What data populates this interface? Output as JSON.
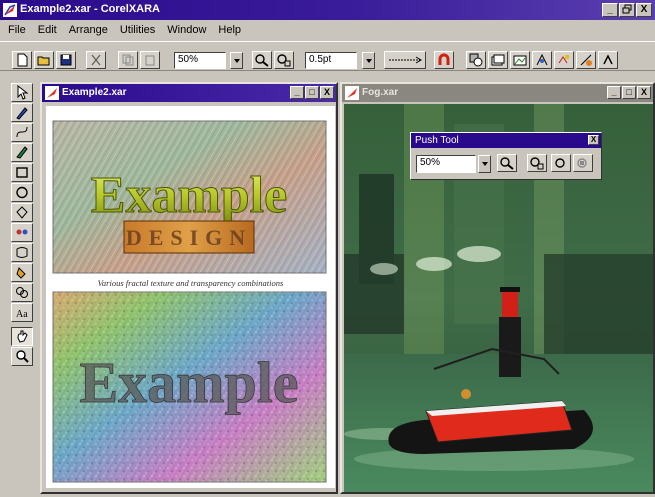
{
  "app": {
    "title": "Example2.xar - CorelXARA",
    "window_controls": [
      "_",
      "á",
      "X"
    ]
  },
  "menu": [
    "File",
    "Edit",
    "Arrange",
    "Utilities",
    "Window",
    "Help"
  ],
  "toolbar": {
    "zoom_value": "50%",
    "line_width_value": "0.5pt"
  },
  "doc1": {
    "title": "Example2.xar",
    "controls": [
      "_",
      "□",
      "X"
    ],
    "art_title": "Example",
    "art_subtitle": "DESIGN",
    "caption": "Various fractal texture and transparency combinations",
    "art_bottom": "Example"
  },
  "doc2": {
    "title": "Fog.xar",
    "controls": [
      "_",
      "□",
      "X"
    ]
  },
  "push_tool": {
    "title": "Push Tool",
    "zoom_value": "50%",
    "close": "X"
  },
  "colors": {
    "titlebar": "#2a0a8c",
    "chrome": "#c9c5bd",
    "fog_green": "#3d6b44"
  },
  "icons": [
    "new-icon",
    "open-icon",
    "save-icon",
    "cut-icon",
    "copy-icon",
    "paste-icon",
    "zoom-icon",
    "zoom-fit-icon",
    "line-style-icon",
    "magnet-icon",
    "arrange-icon",
    "layer-icon",
    "gallery-icon",
    "selector-icon",
    "pen-icon",
    "push-hand-icon",
    "magnify-icon"
  ]
}
